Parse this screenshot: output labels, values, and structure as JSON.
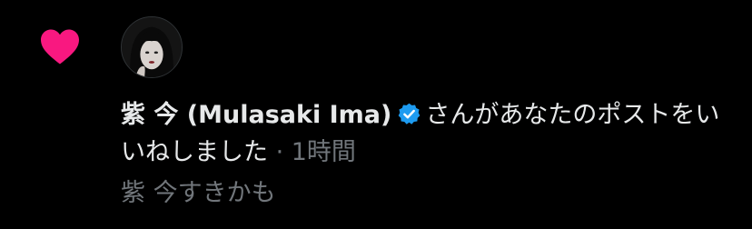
{
  "notification": {
    "type_icon": "heart-icon",
    "user": {
      "name": "紫 今 (Mulasaki Ima)",
      "avatar_icon": "avatar",
      "verified_icon": "verified-badge-icon"
    },
    "action_text": "さんがあなたのポストをいいねしました",
    "separator": " · ",
    "time_ago": "1時間",
    "post_preview": "紫 今すきかも"
  },
  "colors": {
    "background": "#000000",
    "text_primary": "#E7E9EA",
    "text_secondary": "#71767B",
    "like_pink": "#F91880",
    "verified_blue": "#1D9BF0"
  }
}
